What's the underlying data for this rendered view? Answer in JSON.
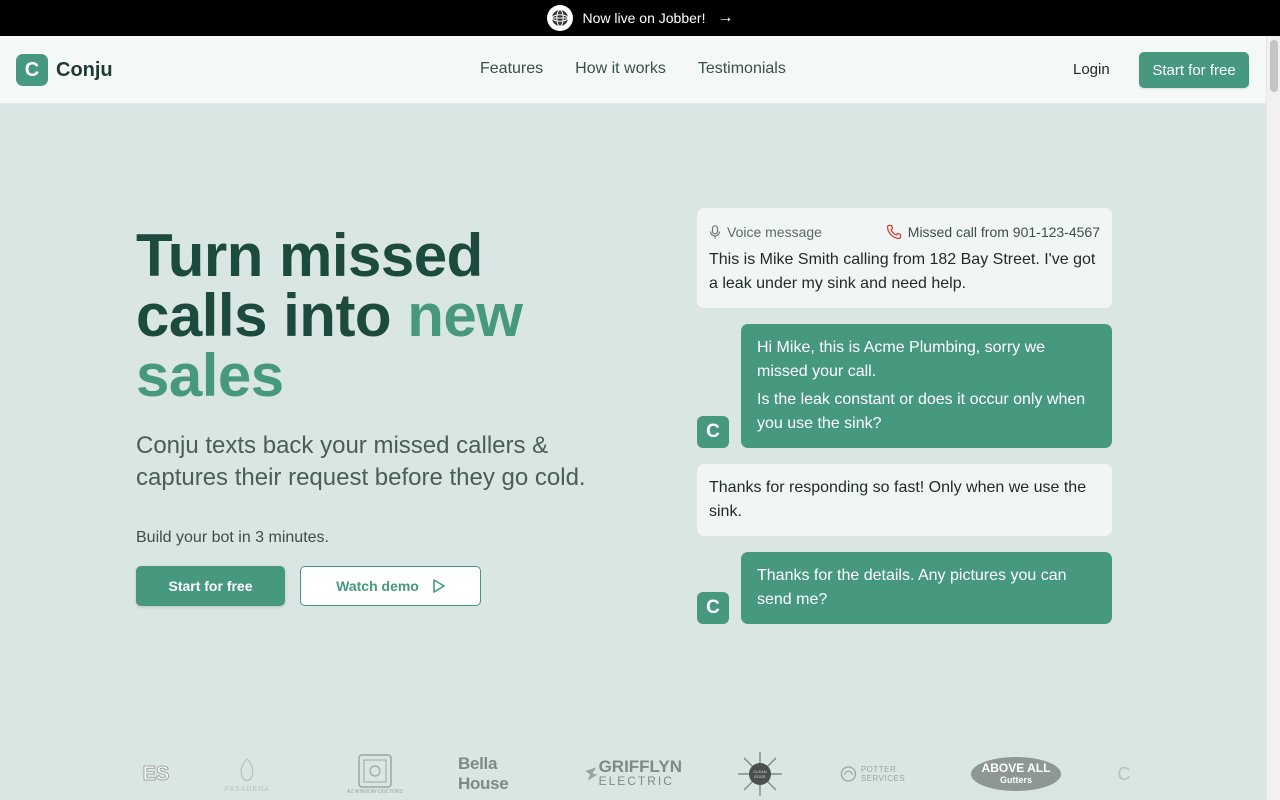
{
  "announcement": {
    "text": "Now live on Jobber!",
    "arrow": "→"
  },
  "header": {
    "brand_initial": "C",
    "brand_name": "Conju",
    "nav_links": [
      "Features",
      "How it works",
      "Testimonials"
    ],
    "login_label": "Login",
    "cta_label": "Start for free"
  },
  "hero": {
    "title_part1": "Turn missed calls into ",
    "title_accent": "new sales",
    "subtitle": "Conju texts back your missed callers & captures their request before they go cold.",
    "note": "Build your bot in 3 minutes.",
    "primary_cta": "Start for free",
    "secondary_cta": "Watch demo"
  },
  "chat": {
    "voice_label": "Voice message",
    "missed_call_label": "Missed call from 901-123-4567",
    "avatar_initial": "C",
    "messages": [
      {
        "from": "caller",
        "lines": [
          "This is Mike Smith calling from 182 Bay Street. I've got a leak under my sink and need help."
        ]
      },
      {
        "from": "bot",
        "lines": [
          "Hi Mike, this is Acme Plumbing, sorry we missed your call.",
          "Is the leak constant or does it occur only when you use the sink?"
        ]
      },
      {
        "from": "caller",
        "lines": [
          "Thanks for responding so fast! Only when we use the sink."
        ]
      },
      {
        "from": "bot",
        "lines": [
          "Thanks for the details. Any pictures you can send me?"
        ]
      }
    ]
  },
  "customer_logos": [
    {
      "text": "ES"
    },
    {
      "text": "PASADENA"
    },
    {
      "text": "AZ WINDOW DOCTORS"
    },
    {
      "text": "Bella House"
    },
    {
      "text": "GRIFFLYN",
      "sub": "ELECTRIC"
    },
    {
      "text": "CLEAN EDGE"
    },
    {
      "text": "POTTER SERVICES"
    },
    {
      "text": "ABOVE ALL",
      "sub": "Gutters"
    },
    {
      "text": "C"
    }
  ],
  "colors": {
    "brand": "#46987f",
    "dark_green": "#1d4a3e",
    "page_bg": "#d9e6e3",
    "missed_call_red": "#d9443a"
  },
  "icons": {
    "announcement_badge": "globe-badge-icon",
    "voice": "microphone-icon",
    "call": "phone-missed-icon",
    "demo": "play-icon"
  }
}
